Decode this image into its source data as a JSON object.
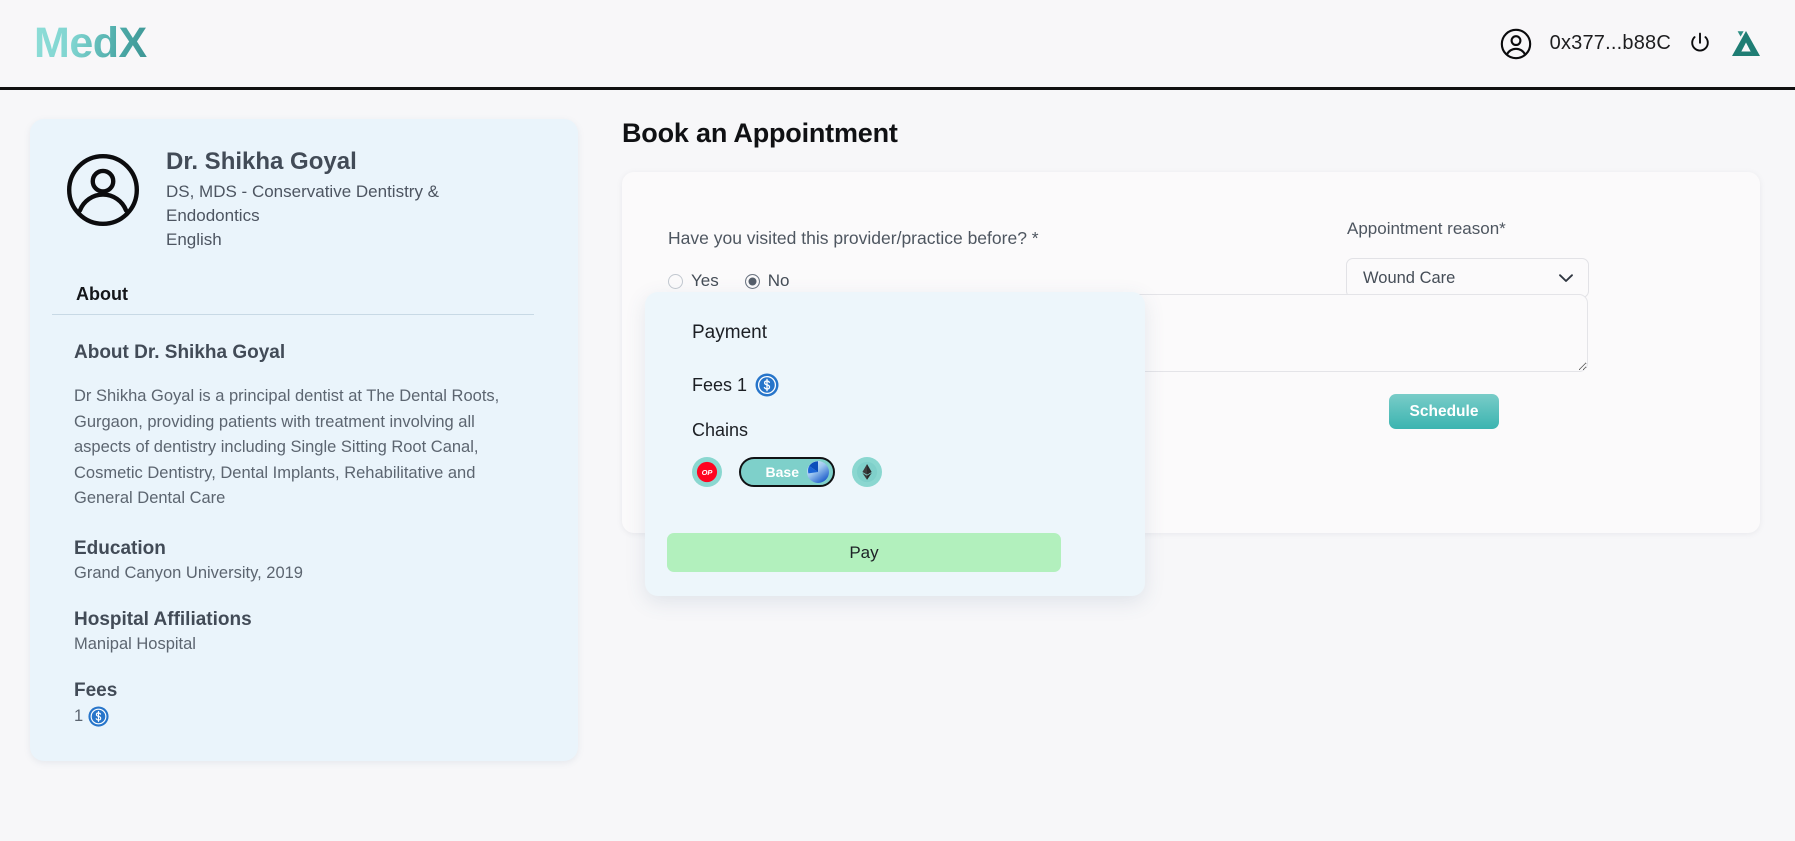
{
  "header": {
    "brand": "MedX",
    "account_icon": "account-circle-icon",
    "wallet_address": "0x377...b88C",
    "power_icon": "power-icon",
    "app_logo": "triangle-logo"
  },
  "profile": {
    "avatar_icon": "avatar-icon",
    "name": "Dr. Shikha Goyal",
    "qualification": "DS, MDS - Conservative Dentistry & Endodontics",
    "language": "English",
    "tab_label": "About",
    "about_title": "About Dr. Shikha Goyal",
    "about_text": "Dr Shikha Goyal is a principal dentist at The Dental Roots, Gurgaon, providing patients with treatment involving all aspects of dentistry including Single Sitting Root Canal, Cosmetic Dentistry, Dental Implants, Rehabilitative and General Dental Care",
    "education_heading": "Education",
    "education_value": "Grand Canyon University, 2019",
    "hospital_heading": "Hospital Affiliations",
    "hospital_value": "Manipal Hospital",
    "fees_heading": "Fees",
    "fees_value": "1",
    "fees_currency_icon": "usdc-coin-icon"
  },
  "booking": {
    "page_title": "Book an Appointment",
    "visited_question": "Have you visited this provider/practice before? *",
    "radio_yes": "Yes",
    "radio_no": "No",
    "selected_answer": "No",
    "reason_label": "Appointment reason*",
    "reason_value": "Wound Care",
    "reason_options": [
      "Wound Care"
    ],
    "note_placeholder": "",
    "note_value": "",
    "schedule_label": "Schedule"
  },
  "payment_modal": {
    "title": "Payment",
    "fees_label": "Fees 1",
    "fees_currency_icon": "usdc-coin-icon",
    "chains_label": "Chains",
    "chains": [
      {
        "name": "OP",
        "icon": "optimism-icon",
        "selected": false
      },
      {
        "name": "Base",
        "icon": "base-icon",
        "selected": true
      },
      {
        "name": "Ethereum",
        "icon": "ethereum-icon",
        "selected": false
      }
    ],
    "pay_label": "Pay"
  },
  "colors": {
    "brand_teal_light": "#8fded8",
    "brand_teal_dark": "#3e9594",
    "card_blue": "#eaf4fb",
    "modal_blue": "#edf6fb",
    "pay_green": "#b2f0bd",
    "usdc_blue": "#2775ca",
    "optimism_red": "#ff0420",
    "chain_chip_teal": "#8ad7d0"
  }
}
